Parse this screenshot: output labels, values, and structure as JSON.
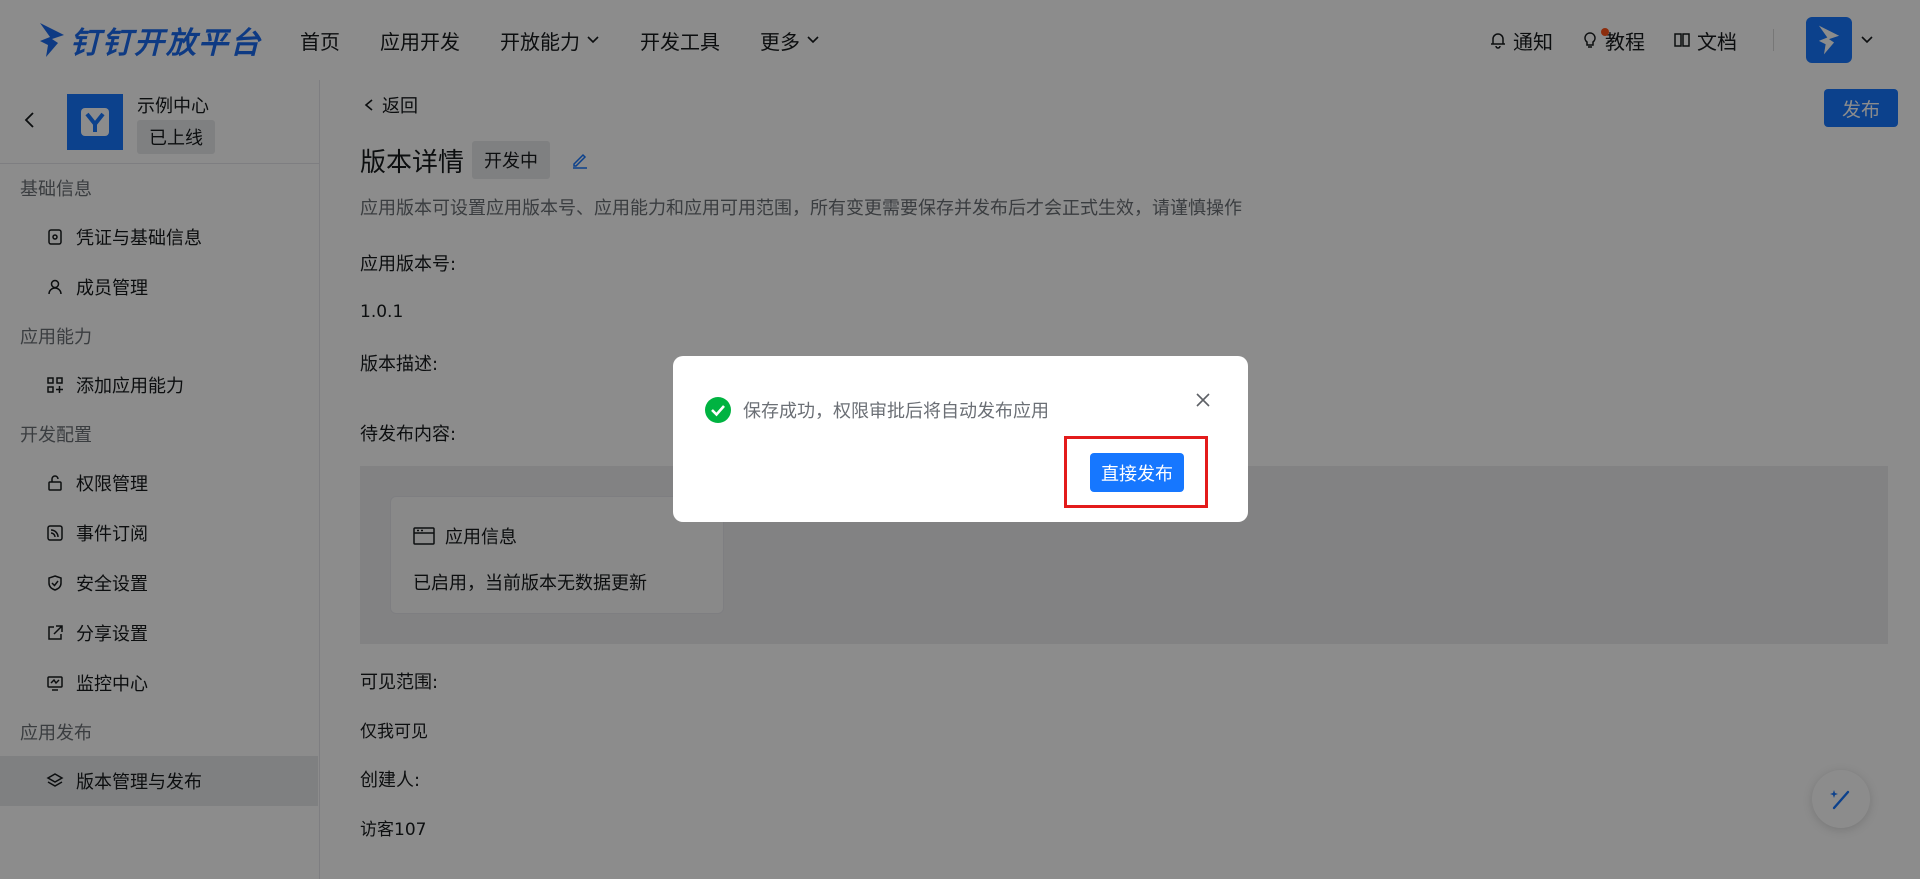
{
  "header": {
    "logo_text": "钉钉开放平台",
    "nav": [
      {
        "label": "首页",
        "dropdown": false
      },
      {
        "label": "应用开发",
        "dropdown": false
      },
      {
        "label": "开放能力",
        "dropdown": true
      },
      {
        "label": "开发工具",
        "dropdown": false
      },
      {
        "label": "更多",
        "dropdown": true
      }
    ],
    "notify_label": "通知",
    "tutorial_label": "教程",
    "docs_label": "文档"
  },
  "sidebar": {
    "app_name": "示例中心",
    "app_status": "已上线",
    "groups": [
      {
        "title": "基础信息",
        "items": [
          {
            "label": "凭证与基础信息",
            "icon": "credential-icon"
          },
          {
            "label": "成员管理",
            "icon": "user-icon"
          }
        ]
      },
      {
        "title": "应用能力",
        "items": [
          {
            "label": "添加应用能力",
            "icon": "add-capability-icon"
          }
        ]
      },
      {
        "title": "开发配置",
        "items": [
          {
            "label": "权限管理",
            "icon": "lock-icon"
          },
          {
            "label": "事件订阅",
            "icon": "rss-icon"
          },
          {
            "label": "安全设置",
            "icon": "shield-icon"
          },
          {
            "label": "分享设置",
            "icon": "share-icon"
          },
          {
            "label": "监控中心",
            "icon": "monitor-icon"
          }
        ]
      },
      {
        "title": "应用发布",
        "items": [
          {
            "label": "版本管理与发布",
            "icon": "layers-icon",
            "active": true
          }
        ]
      }
    ]
  },
  "content": {
    "back_label": "返回",
    "publish_label": "发布",
    "page_title": "版本详情",
    "dev_status": "开发中",
    "description": "应用版本可设置应用版本号、应用能力和应用可用范围，所有变更需要保存并发布后才会正式生效，请谨慎操作",
    "version_label": "应用版本号:",
    "version_value": "1.0.1",
    "version_desc_label": "版本描述:",
    "pending_label": "待发布内容:",
    "card_title": "应用信息",
    "card_body": "已启用，当前版本无数据更新",
    "visibility_label": "可见范围:",
    "visibility_value": "仅我可见",
    "creator_label": "创建人:",
    "creator_value": "访客107"
  },
  "dialog": {
    "message": "保存成功，权限审批后将自动发布应用",
    "button_label": "直接发布"
  },
  "colors": {
    "accent": "#1677ff",
    "success": "#00b341",
    "highlight": "#e31b1b"
  }
}
